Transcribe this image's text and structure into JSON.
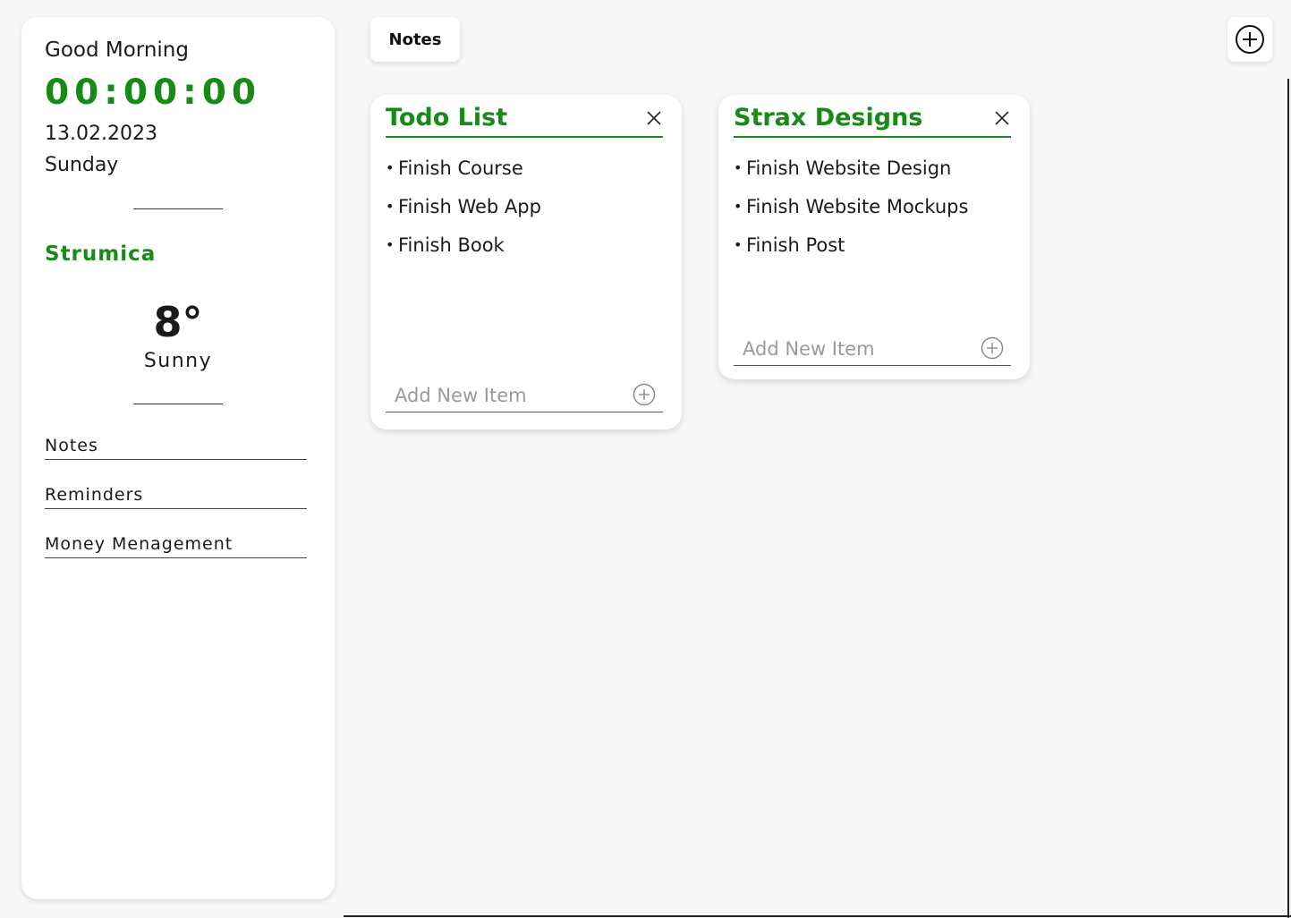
{
  "sidebar": {
    "greeting": "Good Morning",
    "clock": "00:00:00",
    "date": "13.02.2023",
    "day": "Sunday",
    "city": "Strumica",
    "temperature": "8°",
    "condition": "Sunny",
    "nav": [
      {
        "label": "Notes"
      },
      {
        "label": "Reminders"
      },
      {
        "label": "Money Menagement"
      }
    ]
  },
  "header": {
    "tab_label": "Notes",
    "add_icon": "plus-circle-icon"
  },
  "cards": [
    {
      "title": "Todo List",
      "items": [
        "Finish Course",
        "Finish Web App",
        "Finish Book"
      ],
      "placeholder": "Add New Item"
    },
    {
      "title": "Strax Designs",
      "items": [
        "Finish Website Design",
        "Finish Website Mockups",
        "Finish Post"
      ],
      "placeholder": "Add New Item"
    }
  ],
  "colors": {
    "accent": "#178a17",
    "background": "#f7f7f7",
    "card": "#ffffff"
  }
}
